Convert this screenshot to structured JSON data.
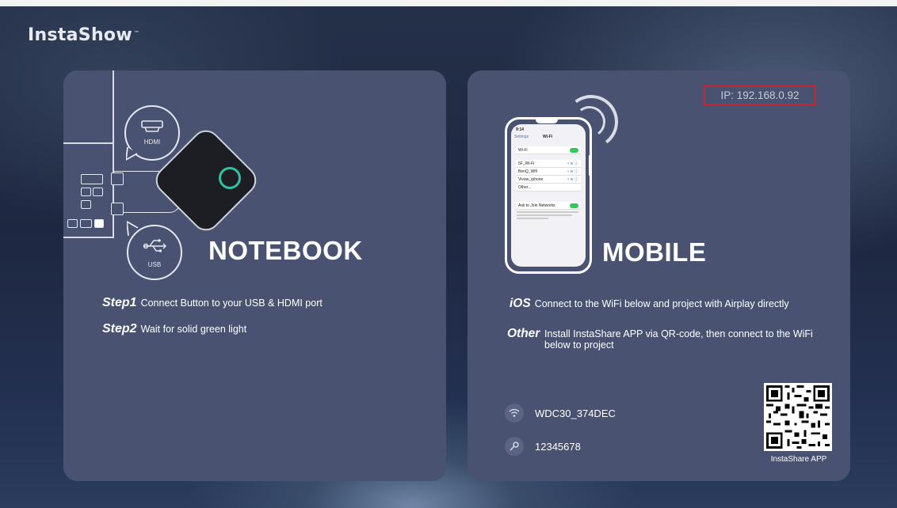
{
  "app": {
    "logo_text": "InstaShow",
    "logo_mark": "™"
  },
  "notebook": {
    "title": "NOTEBOOK",
    "hdmi_label": "HDMI",
    "usb_label": "USB",
    "steps": [
      {
        "label": "Step1",
        "text": "Connect Button to your USB & HDMI port"
      },
      {
        "label": "Step2",
        "text": "Wait for solid green light"
      }
    ]
  },
  "mobile": {
    "title": "MOBILE",
    "ip_text": "IP: 192.168.0.92",
    "phone": {
      "time": "9:14",
      "back": "Settings",
      "header": "Wi-Fi",
      "wifi_row": "Wi-Fi",
      "networks": [
        "5F_Wi-Fi",
        "BenQ_Wifi",
        "Vivian_iphone",
        "Other..."
      ],
      "ask_row": "Ask to Join Networks"
    },
    "ios": {
      "label": "iOS",
      "text": "Connect to the WiFi below and project with Airplay directly"
    },
    "other": {
      "label": "Other",
      "text": "Install InstaShare APP via QR-code, then connect to the WiFi below to project"
    },
    "ssid": "WDC30_374DEC",
    "password": "12345678",
    "qr_caption": "InstaShare APP"
  },
  "icons": {
    "wifi": "wifi-icon",
    "key": "key-icon",
    "hdmi": "hdmi-icon",
    "usb": "usb-icon"
  }
}
